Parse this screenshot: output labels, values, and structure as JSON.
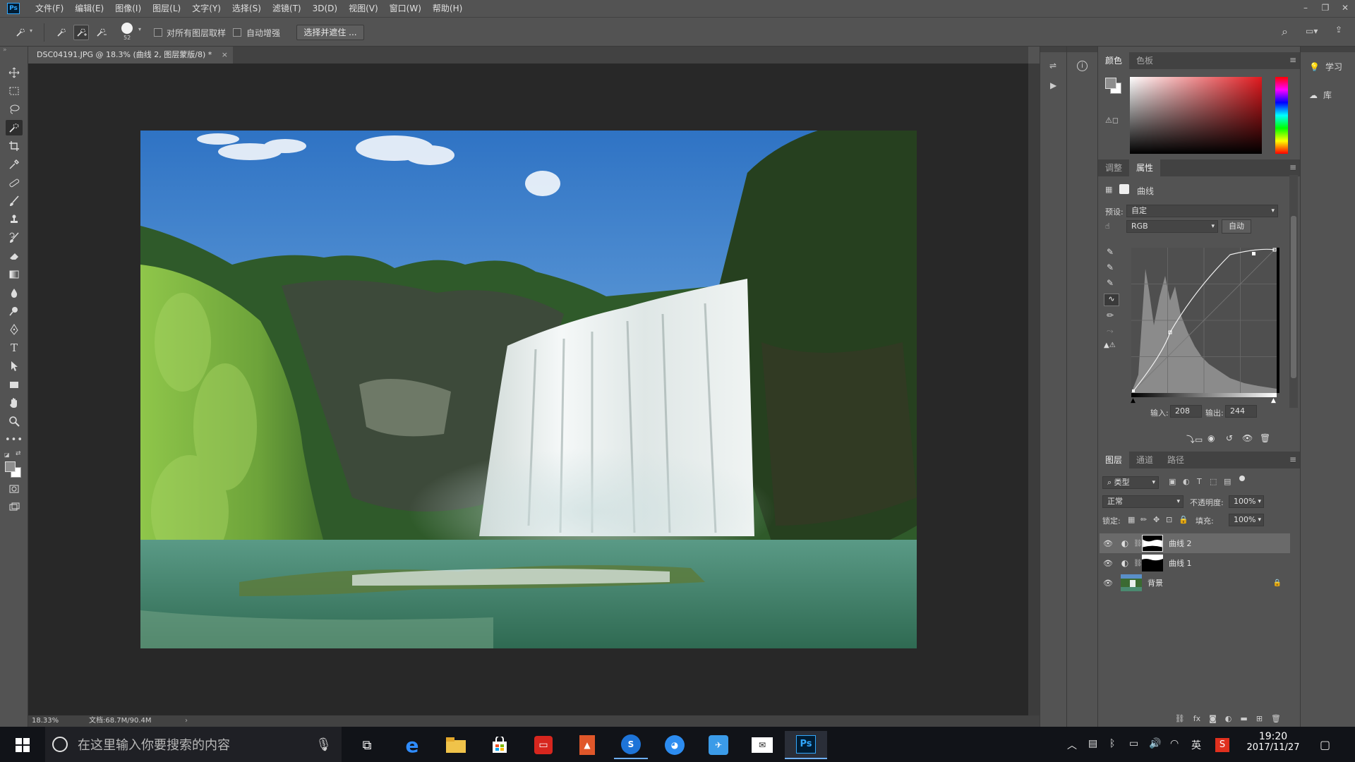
{
  "app": {
    "logo": "Ps"
  },
  "menu": [
    "文件(F)",
    "编辑(E)",
    "图像(I)",
    "图层(L)",
    "文字(Y)",
    "选择(S)",
    "滤镜(T)",
    "3D(D)",
    "视图(V)",
    "窗口(W)",
    "帮助(H)"
  ],
  "options_bar": {
    "brush_size": "52",
    "sample_all_layers": "对所有图层取样",
    "auto_enhance": "自动增强",
    "select_and_mask": "选择并遮住 ..."
  },
  "document": {
    "tab_title": "DSC04191.JPG @ 18.3% (曲线 2, 图层蒙版/8) *",
    "zoom": "18.33%",
    "doc_size": "文档:68.7M/90.4M"
  },
  "color_panel": {
    "tabs": [
      "颜色",
      "色板"
    ]
  },
  "properties_panel": {
    "tabs": [
      "调整",
      "属性"
    ],
    "adjustment_title": "曲线",
    "preset_label": "预设:",
    "preset_value": "自定",
    "channel": "RGB",
    "auto_button": "自动",
    "input_label": "输入:",
    "input_value": "208",
    "output_label": "输出:",
    "output_value": "244"
  },
  "layers_panel": {
    "tabs": [
      "图层",
      "通道",
      "路径"
    ],
    "filter_kind": "类型",
    "blend_mode": "正常",
    "opacity_label": "不透明度:",
    "opacity_value": "100%",
    "lock_label": "锁定:",
    "fill_label": "填充:",
    "fill_value": "100%",
    "layers": [
      {
        "name": "曲线 2",
        "selected": true
      },
      {
        "name": "曲线 1",
        "selected": false
      },
      {
        "name": "背景",
        "selected": false
      }
    ]
  },
  "side_dock": {
    "learn": "学习",
    "libraries": "库"
  },
  "taskbar": {
    "search_placeholder": "在这里输入你要搜索的内容",
    "ime": "英",
    "time": "19:20",
    "date": "2017/11/27"
  },
  "colors": {
    "ps_blue": "#31a8ff",
    "panel_bg": "#535353",
    "canvas_bg": "#282828",
    "taskbar_bg": "#111318"
  }
}
